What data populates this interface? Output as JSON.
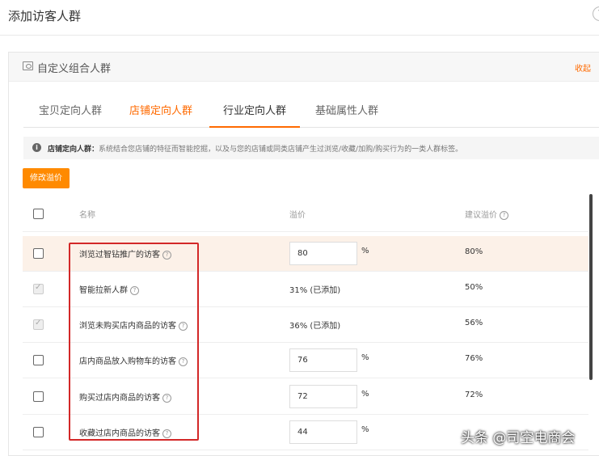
{
  "dialog": {
    "title": "添加访客人群",
    "close_icon": "?"
  },
  "panel": {
    "title": "自定义组合人群",
    "collapse_label": "收起"
  },
  "tabs": [
    {
      "label": "宝贝定向人群",
      "state": "normal"
    },
    {
      "label": "店铺定向人群",
      "state": "highlighted"
    },
    {
      "label": "行业定向人群",
      "state": "active"
    },
    {
      "label": "基础属性人群",
      "state": "normal"
    }
  ],
  "info": {
    "icon": "i",
    "label": "店铺定向人群：",
    "text": "系统结合您店铺的特征而智能挖掘，以及与您的店铺或同类店铺产生过浏览/收藏/加购/购买行为的一类人群标签。"
  },
  "edit_button_label": "修改溢价",
  "table": {
    "headers": {
      "name": "名称",
      "bid": "溢价",
      "suggested": "建议溢价"
    },
    "rows": [
      {
        "name": "浏览过智钻推广的访客",
        "bid_value": "80",
        "bid_unit": "%",
        "suggested": "80%",
        "checked": false,
        "added": false,
        "added_text": ""
      },
      {
        "name": "智能拉新人群",
        "bid_value": "",
        "bid_unit": "",
        "suggested": "50%",
        "checked": true,
        "added": true,
        "added_text": "31% (已添加)"
      },
      {
        "name": "浏览未购买店内商品的访客",
        "bid_value": "",
        "bid_unit": "",
        "suggested": "56%",
        "checked": true,
        "added": true,
        "added_text": "36% (已添加)"
      },
      {
        "name": "店内商品放入购物车的访客",
        "bid_value": "76",
        "bid_unit": "%",
        "suggested": "76%",
        "checked": false,
        "added": false,
        "added_text": ""
      },
      {
        "name": "购买过店内商品的访客",
        "bid_value": "72",
        "bid_unit": "%",
        "suggested": "72%",
        "checked": false,
        "added": false,
        "added_text": ""
      },
      {
        "name": "收藏过店内商品的访客",
        "bid_value": "44",
        "bid_unit": "%",
        "suggested": "",
        "checked": false,
        "added": false,
        "added_text": ""
      }
    ]
  },
  "watermark": "头条 @司空电商会",
  "colors": {
    "accent": "#ff6a00",
    "button": "#ff8a00",
    "highlight_row": "#fcf1e8",
    "annotation_box": "#d32828"
  }
}
